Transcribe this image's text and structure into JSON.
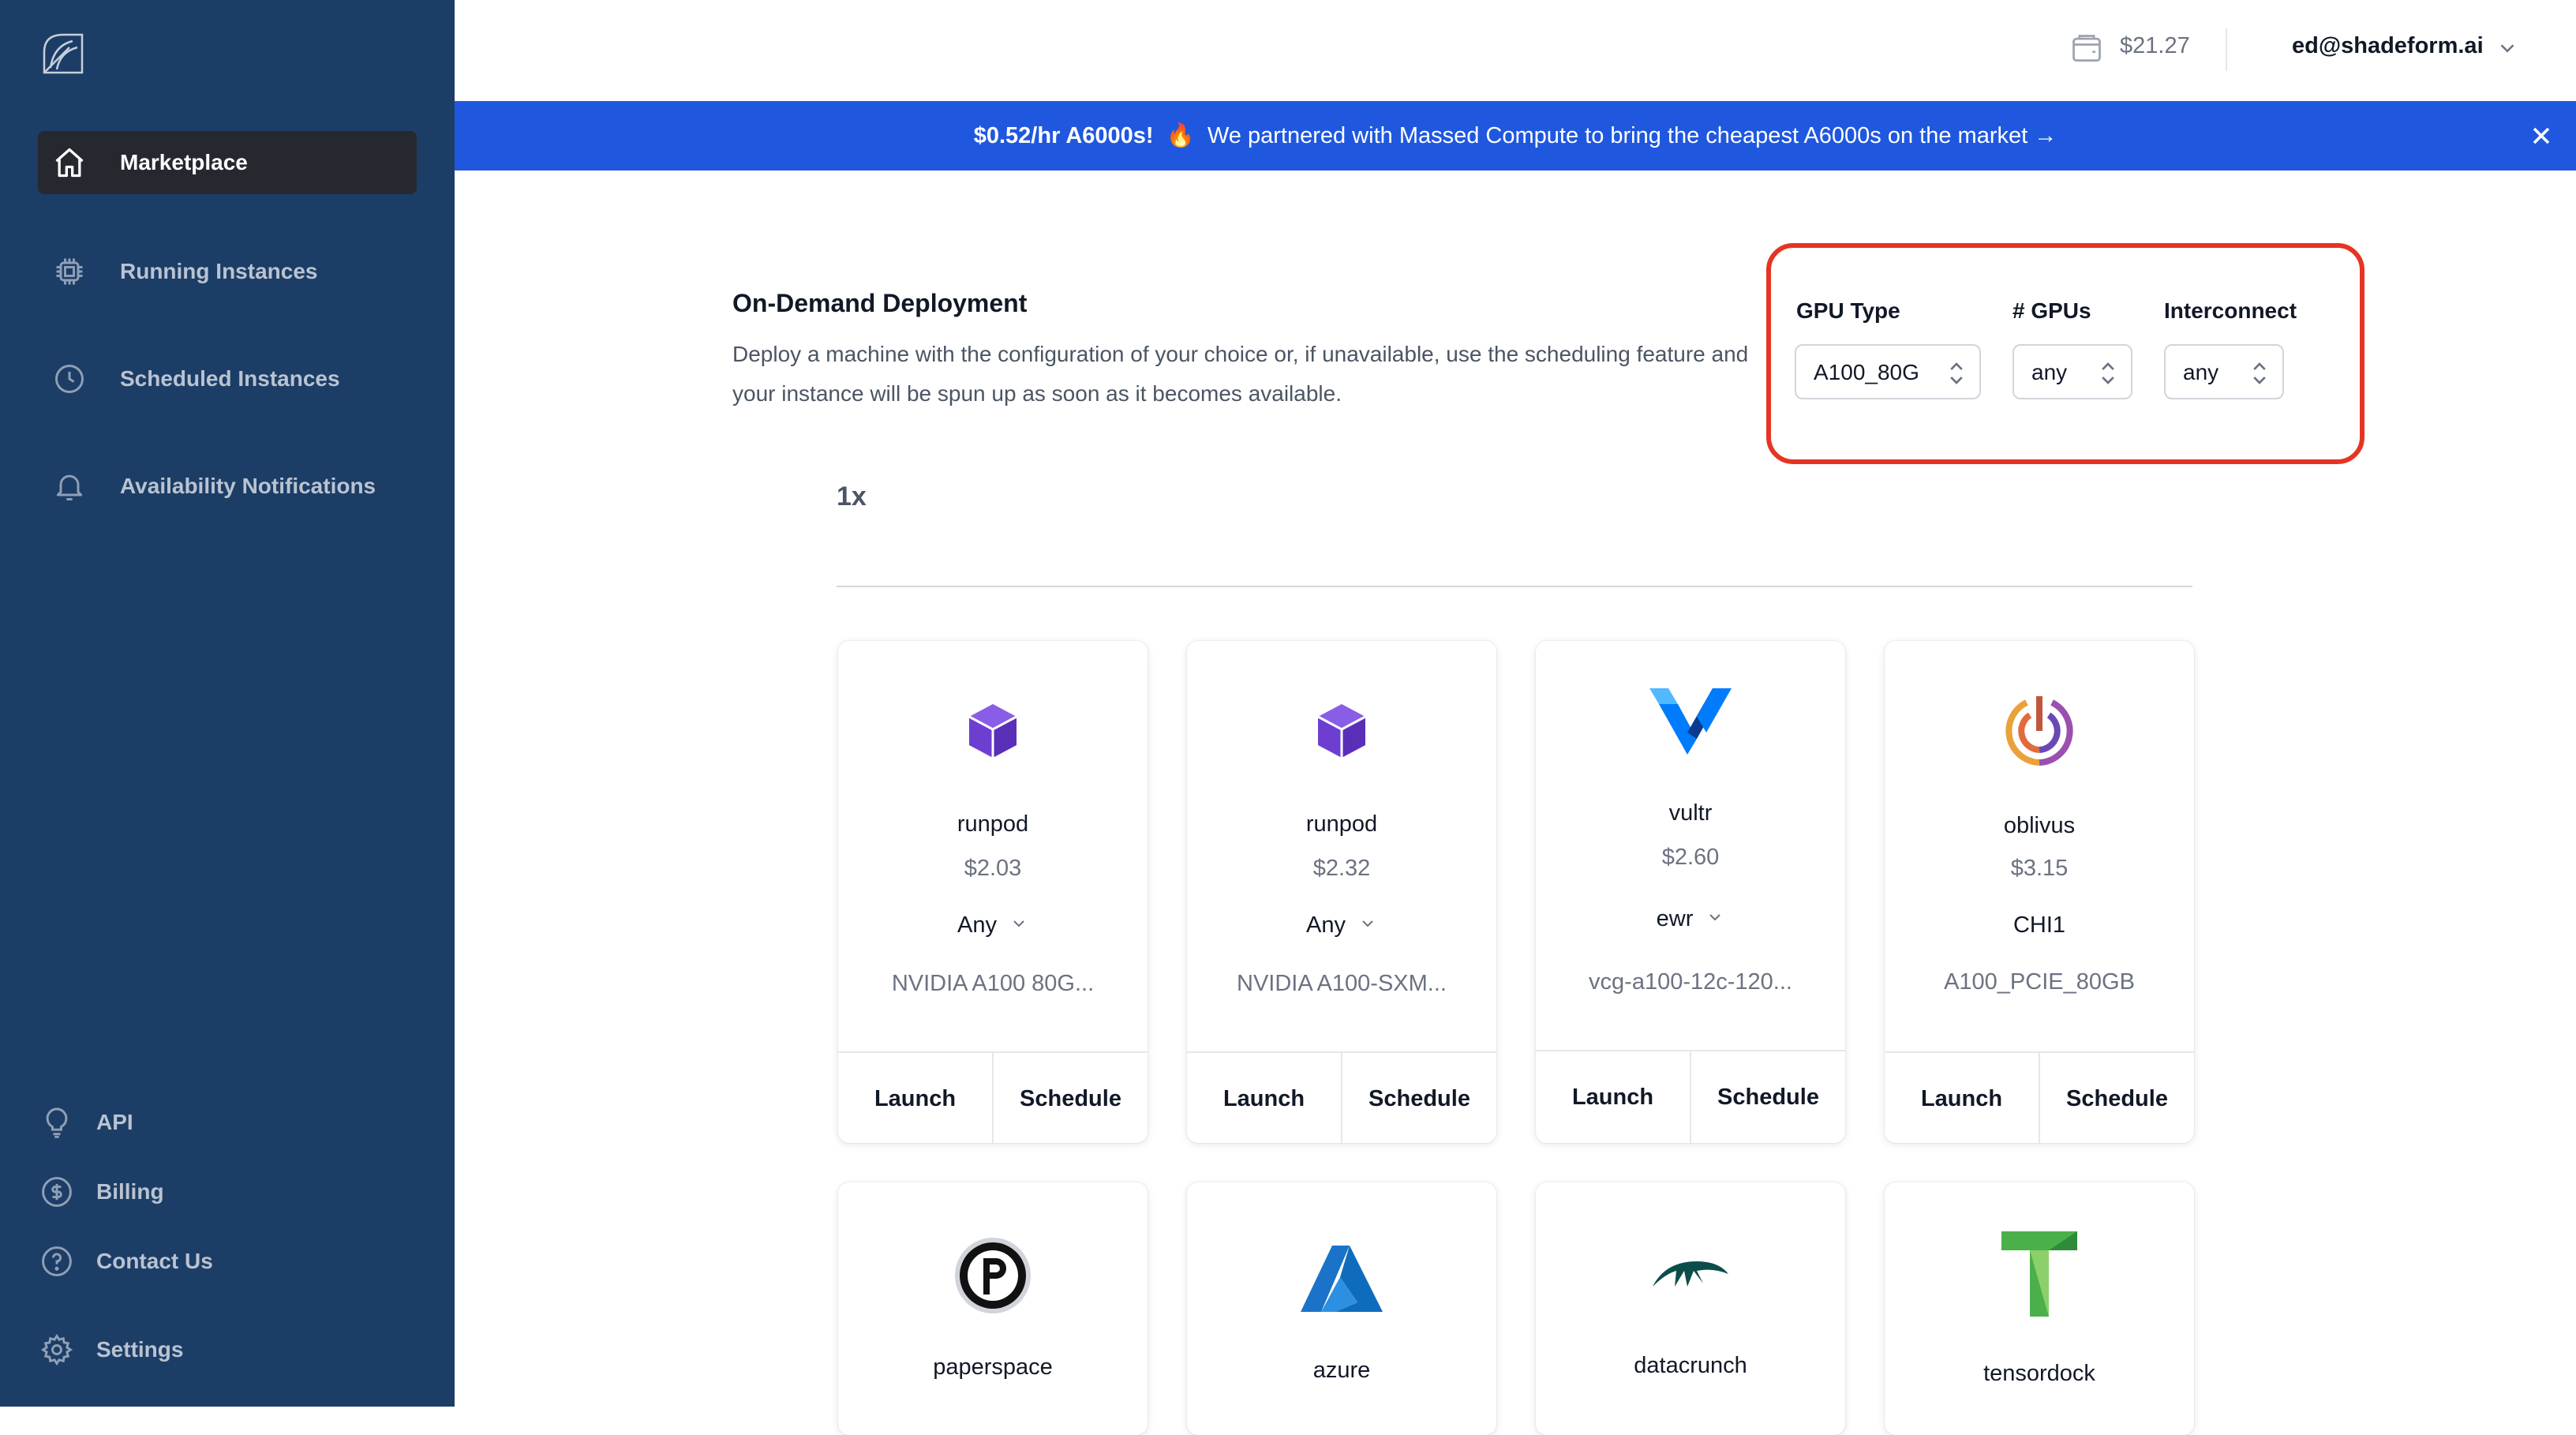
{
  "sidebar": {
    "nav": [
      {
        "label": "Marketplace",
        "icon": "home-icon",
        "active": true
      },
      {
        "label": "Running Instances",
        "icon": "chip-icon",
        "active": false
      },
      {
        "label": "Scheduled Instances",
        "icon": "clock-icon",
        "active": false
      },
      {
        "label": "Availability Notifications",
        "icon": "bell-icon",
        "active": false
      }
    ],
    "bottom": [
      {
        "label": "API",
        "icon": "lightbulb-icon"
      },
      {
        "label": "Billing",
        "icon": "dollar-circle-icon"
      },
      {
        "label": "Contact Us",
        "icon": "question-circle-icon"
      },
      {
        "label": "Settings",
        "icon": "gear-icon"
      }
    ]
  },
  "header": {
    "balance": "$21.27",
    "user_email": "ed@shadeform.ai"
  },
  "banner": {
    "headline": "$0.52/hr A6000s!",
    "emoji": "🔥",
    "message": "We partnered with Massed Compute to bring the cheapest A6000s on the market →"
  },
  "deployment": {
    "title": "On-Demand Deployment",
    "description": "Deploy a machine with the configuration of your choice or, if unavailable, use the scheduling feature and your instance will be spun up as soon as it becomes available."
  },
  "filters": {
    "gpu_type": {
      "label": "GPU Type",
      "value": "A100_80G"
    },
    "num_gpus": {
      "label": "# GPUs",
      "value": "any"
    },
    "interconnect": {
      "label": "Interconnect",
      "value": "any"
    }
  },
  "group_label": "1x",
  "cards": [
    {
      "provider": "runpod",
      "price": "$2.03",
      "region": "Any",
      "region_dropdown": true,
      "model": "NVIDIA A100 80G...",
      "launch": "Launch",
      "schedule": "Schedule"
    },
    {
      "provider": "runpod",
      "price": "$2.32",
      "region": "Any",
      "region_dropdown": true,
      "model": "NVIDIA A100-SXM...",
      "launch": "Launch",
      "schedule": "Schedule"
    },
    {
      "provider": "vultr",
      "price": "$2.60",
      "region": "ewr",
      "region_dropdown": true,
      "model": "vcg-a100-12c-120...",
      "launch": "Launch",
      "schedule": "Schedule"
    },
    {
      "provider": "oblivus",
      "price": "$3.15",
      "region": "CHI1",
      "region_dropdown": false,
      "model": "A100_PCIE_80GB",
      "launch": "Launch",
      "schedule": "Schedule"
    },
    {
      "provider": "paperspace"
    },
    {
      "provider": "azure"
    },
    {
      "provider": "datacrunch"
    },
    {
      "provider": "tensordock"
    }
  ],
  "colors": {
    "sidebar": "#1c3d66",
    "banner": "#1f58df",
    "highlight": "#e53522",
    "runpod": "#6d3fd1",
    "azure": "#0f6cbd"
  }
}
